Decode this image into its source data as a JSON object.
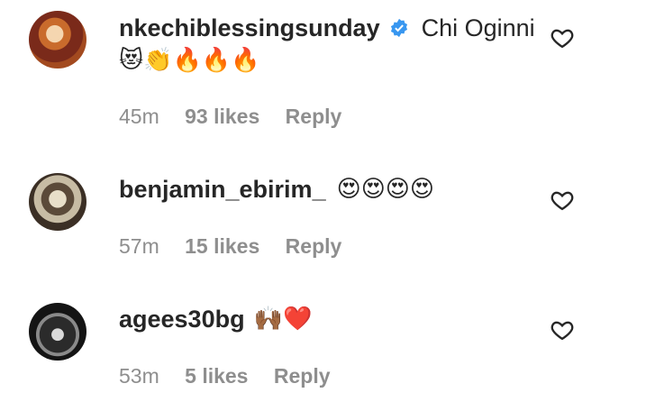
{
  "comments": [
    {
      "username": "nkechiblessingsunday",
      "verified": true,
      "text": "Chi Oginni",
      "emojis": "😻👏🔥🔥🔥",
      "time": "45m",
      "likes": "93 likes",
      "reply_label": "Reply"
    },
    {
      "username": "benjamin_ebirim_",
      "verified": false,
      "text": "",
      "emojis": "😍😍😍😍",
      "time": "57m",
      "likes": "15 likes",
      "reply_label": "Reply"
    },
    {
      "username": "agees30bg",
      "verified": false,
      "text": "",
      "emojis": "🙌🏾❤️",
      "time": "53m",
      "likes": "5 likes",
      "reply_label": "Reply"
    }
  ]
}
